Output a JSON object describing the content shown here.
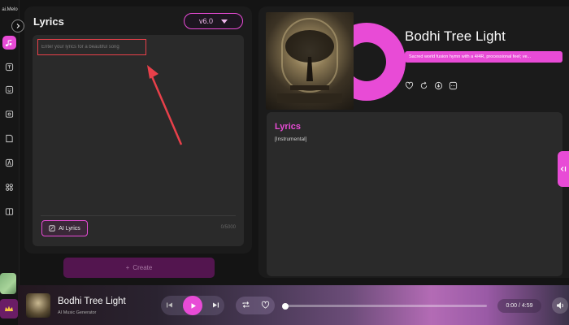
{
  "app": {
    "brand": "ai.Melo"
  },
  "colors": {
    "accent": "#e84bd6",
    "panel": "#1b1b1b",
    "background": "#141414",
    "annotation": "#e8404a"
  },
  "sidebar": {
    "items": [
      {
        "icon": "music-note-icon",
        "active": true
      },
      {
        "icon": "text-icon"
      },
      {
        "icon": "emoji-icon"
      },
      {
        "icon": "image-icon"
      },
      {
        "icon": "note-icon"
      },
      {
        "icon": "contrast-icon"
      },
      {
        "icon": "apps-grid-icon"
      },
      {
        "icon": "book-icon"
      }
    ]
  },
  "lyrics_panel": {
    "title": "Lyrics",
    "version": "v6.0",
    "placeholder": "Enter your lyrics for a beautiful song",
    "ai_button": "AI Lyrics",
    "char_count": "0/5000",
    "create_button": "Create"
  },
  "song": {
    "title": "Bodhi Tree Light",
    "tag": "Sacred world fusion hymn with a 4/4R, processional feel; ve...",
    "actions": [
      "heart-icon",
      "remix-icon",
      "download-icon",
      "more-icon"
    ],
    "lyrics_title": "Lyrics",
    "lyrics_text": "[Instrumental]"
  },
  "player": {
    "title": "Bodhi Tree Light",
    "subtitle": "AI Music Generator",
    "time": "0:00 / 4:59",
    "progress": 0.0
  }
}
